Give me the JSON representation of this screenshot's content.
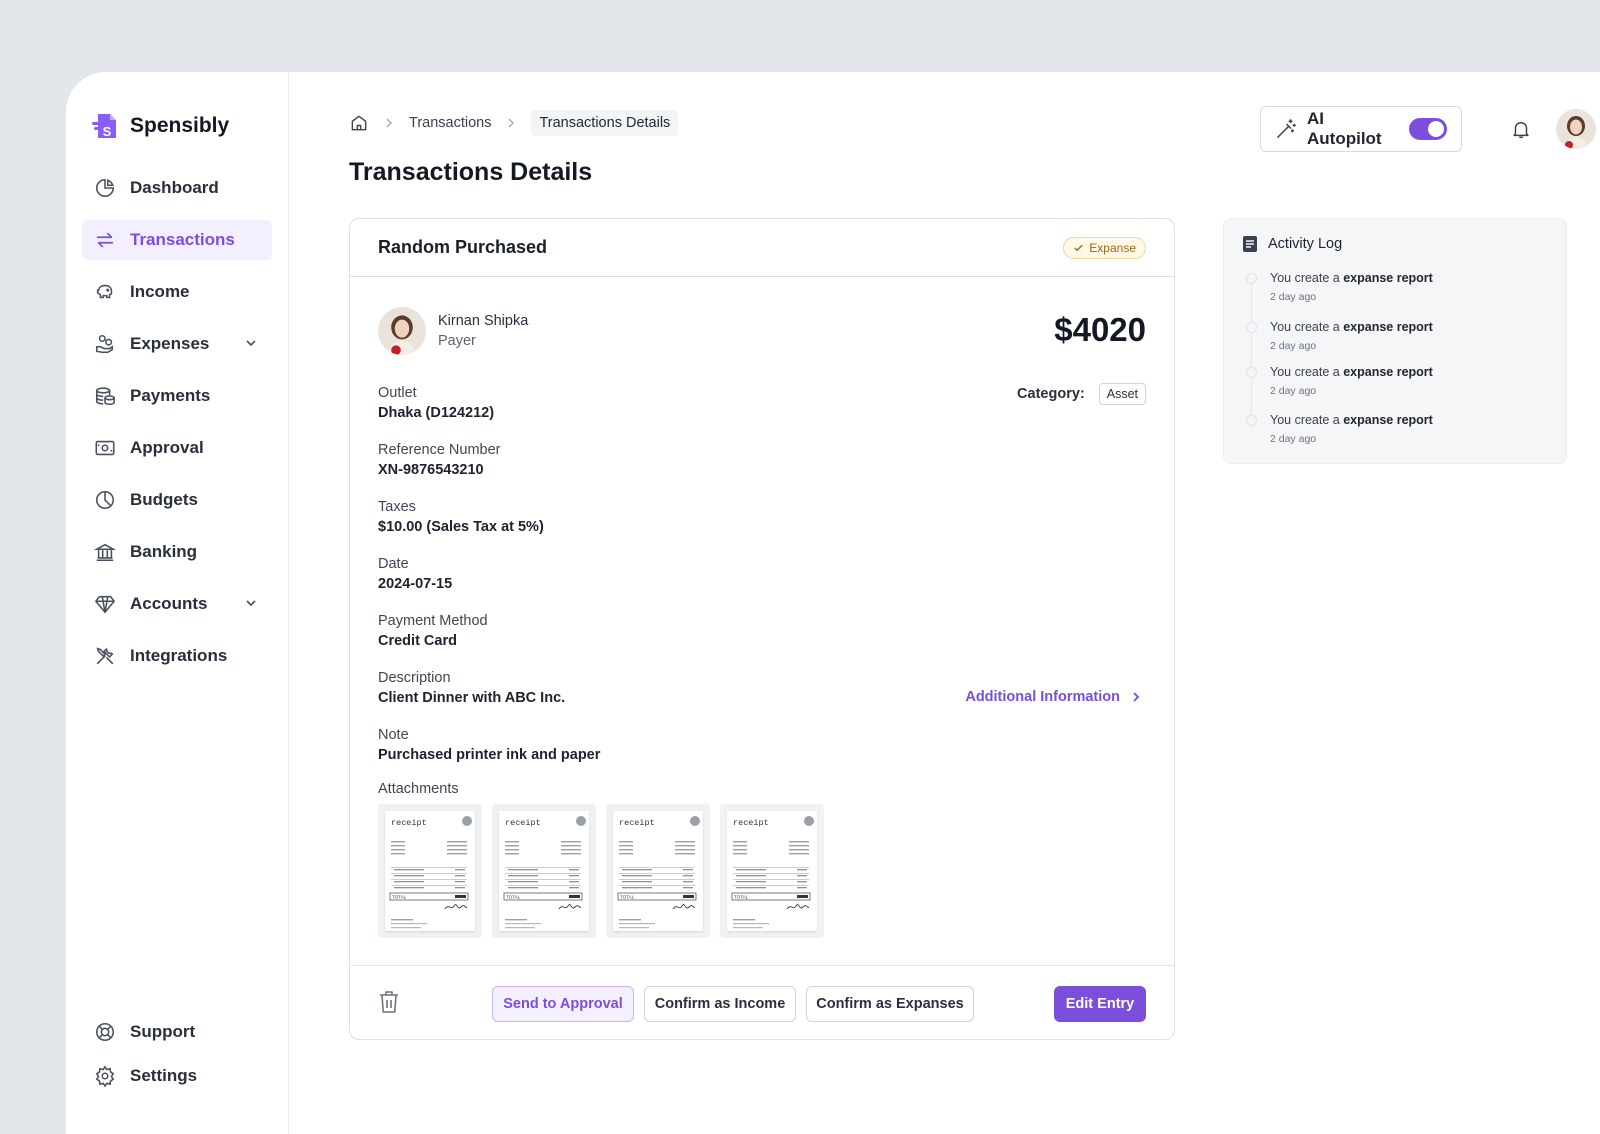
{
  "app": {
    "name": "Spensibly"
  },
  "sidebar": {
    "items": [
      {
        "label": "Dashboard",
        "icon": "dashboard-icon"
      },
      {
        "label": "Transactions",
        "icon": "transactions-icon",
        "active": true
      },
      {
        "label": "Income",
        "icon": "piggy-bank-icon"
      },
      {
        "label": "Expenses",
        "icon": "expenses-icon",
        "expandable": true
      },
      {
        "label": "Payments",
        "icon": "coins-icon"
      },
      {
        "label": "Approval",
        "icon": "approval-icon"
      },
      {
        "label": "Budgets",
        "icon": "pie-chart-icon"
      },
      {
        "label": "Banking",
        "icon": "bank-icon"
      },
      {
        "label": "Accounts",
        "icon": "diamond-icon",
        "expandable": true
      },
      {
        "label": "Integrations",
        "icon": "tools-icon"
      }
    ],
    "bottom": [
      {
        "label": "Support",
        "icon": "lifebuoy-icon"
      },
      {
        "label": "Settings",
        "icon": "gear-icon"
      }
    ]
  },
  "breadcrumb": {
    "items": [
      "Transactions",
      "Transactions Details"
    ]
  },
  "page": {
    "title": "Transactions Details"
  },
  "topbar": {
    "ai_label": "AI Autopilot",
    "ai_enabled": true
  },
  "transaction": {
    "title": "Random Purchased",
    "type_badge": "Expanse",
    "payer_name": "Kirnan Shipka",
    "payer_role": "Payer",
    "amount": "$4020",
    "category_label": "Category:",
    "category": "Asset",
    "fields": [
      {
        "label": "Outlet",
        "value": "Dhaka (D124212)"
      },
      {
        "label": "Reference Number",
        "value": "XN-9876543210"
      },
      {
        "label": "Taxes",
        "value": "$10.00 (Sales Tax at 5%)"
      },
      {
        "label": "Date",
        "value": "2024-07-15"
      },
      {
        "label": "Payment Method",
        "value": "Credit Card"
      },
      {
        "label": "Description",
        "value": "Client Dinner with ABC Inc."
      },
      {
        "label": "Note",
        "value": "Purchased printer ink and paper"
      }
    ],
    "additional_info": "Additional Information",
    "attachments_label": "Attachments",
    "attachment_caption": "receipt",
    "attachment_total_label": "TOTAL"
  },
  "actions": {
    "send_approval": "Send to Approval",
    "confirm_income": "Confirm as Income",
    "confirm_expanses": "Confirm as Expanses",
    "edit": "Edit Entry"
  },
  "activity": {
    "title": "Activity Log",
    "items": [
      {
        "prefix": "You create a",
        "highlight": "expanse report",
        "time": "2 day ago"
      },
      {
        "prefix": "You create a",
        "highlight": "expanse report",
        "time": "2 day ago"
      },
      {
        "prefix": "You create a",
        "highlight": "expanse report",
        "time": "2 day ago"
      },
      {
        "prefix": "You create a",
        "highlight": "expanse report",
        "time": "2 day ago"
      }
    ]
  },
  "colors": {
    "accent": "#7b4fdc",
    "accent_bg": "#f3efff",
    "badge_bg": "#fff8e6",
    "badge_text": "#9a6a18"
  }
}
